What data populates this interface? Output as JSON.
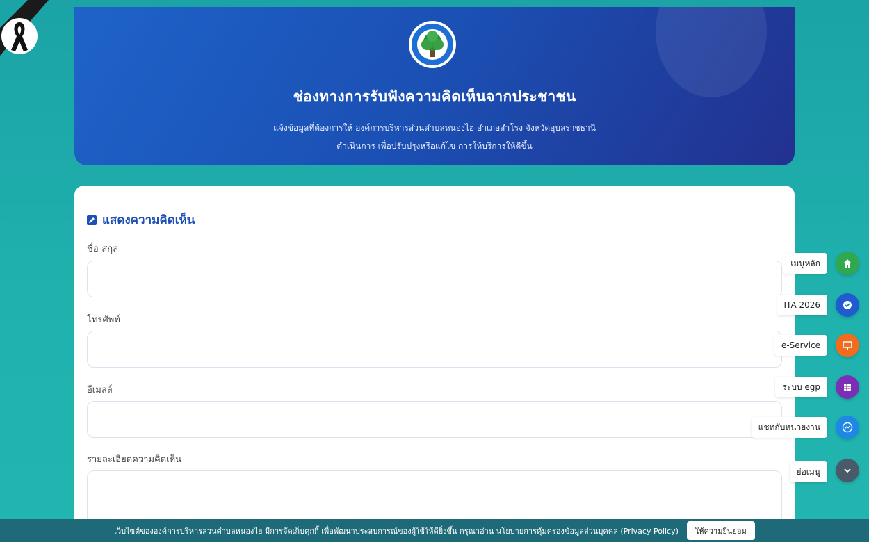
{
  "hero": {
    "title": "ช่องทางการรับฟังความคิดเห็นจากประชาชน",
    "subtitle_1": "แจ้งข้อมูลที่ต้องการให้ องค์การบริหารส่วนตำบลหนองไฮ อำเภอสำโรง จังหวัดอุบลราชธานี",
    "subtitle_2": "ดำเนินการ เพื่อปรับปรุงหรือแก้ไข การให้บริการให้ดีขึ้น"
  },
  "form": {
    "heading": "แสดงความคิดเห็น",
    "fields": [
      {
        "label": "ชื่อ-สกุล",
        "value": "",
        "placeholder": ""
      },
      {
        "label": "โทรศัพท์",
        "value": "",
        "placeholder": ""
      },
      {
        "label": "อีเมลล์",
        "value": "",
        "placeholder": ""
      },
      {
        "label": "รายละเอียดความคิดเห็น",
        "value": "",
        "placeholder": ""
      }
    ]
  },
  "floating_menu": [
    {
      "label": "เมนูหลัก",
      "icon": "home-icon",
      "color": "#2fa84f"
    },
    {
      "label": "ITA 2026",
      "icon": "badge-check-icon",
      "color": "#1f5ccf"
    },
    {
      "label": "e-Service",
      "icon": "monitor-icon",
      "color": "#f26c1d"
    },
    {
      "label": "ระบบ egp",
      "icon": "grid-icon",
      "color": "#7b2fb5"
    },
    {
      "label": "แชทกับหน่วยงาน",
      "icon": "messenger-icon",
      "color": "#1e88e5"
    },
    {
      "label": "ย่อเมนู",
      "icon": "chevron-down-icon",
      "color": "#4a5a6a"
    }
  ],
  "cookie": {
    "message": "เว็บไซต์ขององค์การบริหารส่วนตำบลหนองไฮ มีการจัดเก็บคุกกี้ เพื่อพัฒนาประสบการณ์ของผู้ใช้ให้ดียิ่งขึ้น กรุณาอ่าน นโยบายการคุ้มครองข้อมูลส่วนบุคคล (Privacy Policy)",
    "accept_label": "ให้ความยินยอม"
  }
}
